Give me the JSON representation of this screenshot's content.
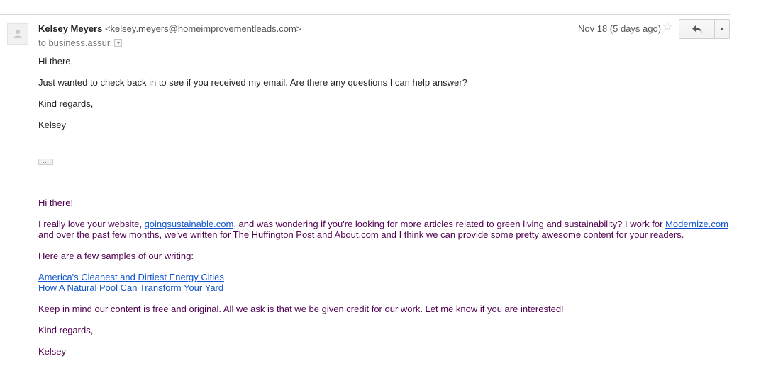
{
  "header": {
    "sender_name": "Kelsey Meyers",
    "sender_email": "<kelsey.meyers@homeimprovementleads.com>",
    "recipient": "to business.assur.",
    "date": "Nov 18 (5 days ago)"
  },
  "icons": {
    "avatar": "person-silhouette-icon",
    "star": "star-icon",
    "reply": "reply-arrow-icon",
    "more": "chevron-down-icon",
    "recipient_details": "caret-down-icon"
  },
  "body": {
    "greeting": "Hi there,",
    "line1": "Just wanted to check back in to see if you received my email. Are there any questions I can help answer?",
    "closing": "Kind regards,",
    "signature": "Kelsey",
    "sig_sep": "--",
    "show_trimmed": "…"
  },
  "quoted": {
    "greeting": "Hi there!",
    "p1_before": "I really love your website, ",
    "p1_link": "goingsustainable.com",
    "p1_middle": ", and was wondering if you're looking for more articles related to green living and sustainability? I work for ",
    "p1_link2": "Modernize.com",
    "p1_line2": "and over the past few months, we've written for The Huffington Post and About.com and I think we can provide some pretty awesome content for your readers.",
    "samples_intro": "Here are a few samples of our writing:",
    "sample_links": [
      "America's Cleanest and Dirtiest Energy Cities",
      "How A Natural Pool Can Transform Your Yard"
    ],
    "p3": "Keep in mind our content is free and original. All we ask is that we be given credit for our work. Let me know if you are interested!",
    "closing": "Kind regards,",
    "signature": "Kelsey"
  },
  "colors": {
    "link": "#1155cc",
    "quoted_text": "#500050",
    "text": "#222222"
  }
}
